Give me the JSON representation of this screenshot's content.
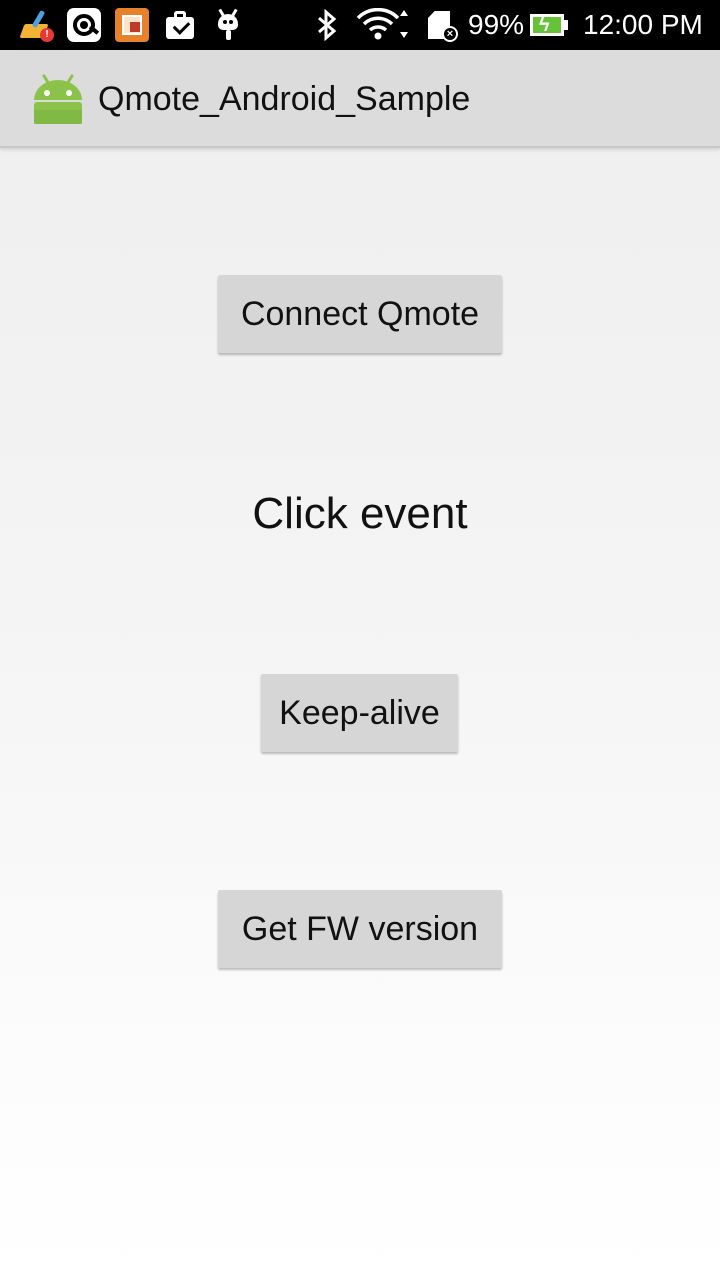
{
  "status_bar": {
    "icons": [
      "cleaner-alert-icon",
      "scan-app-icon",
      "photo-app-icon",
      "shopping-bag-icon",
      "bug-droid-icon",
      "bluetooth-icon",
      "wifi-icon",
      "sd-card-error-icon",
      "battery-charging-icon"
    ],
    "battery_percent": "99%",
    "time": "12:00 PM",
    "colors": {
      "background": "#000000",
      "battery_fill": "#67c23a"
    }
  },
  "action_bar": {
    "title": "Qmote_Android_Sample",
    "icon": "android-app-icon",
    "colors": {
      "background": "#dcdcdc",
      "android_green": "#8bc34a"
    }
  },
  "main": {
    "connect_button_label": "Connect Qmote",
    "event_text": "Click event",
    "keepalive_button_label": "Keep-alive",
    "fw_button_label": "Get FW version"
  },
  "colors": {
    "button_background": "#d6d6d6",
    "text": "#111111"
  }
}
